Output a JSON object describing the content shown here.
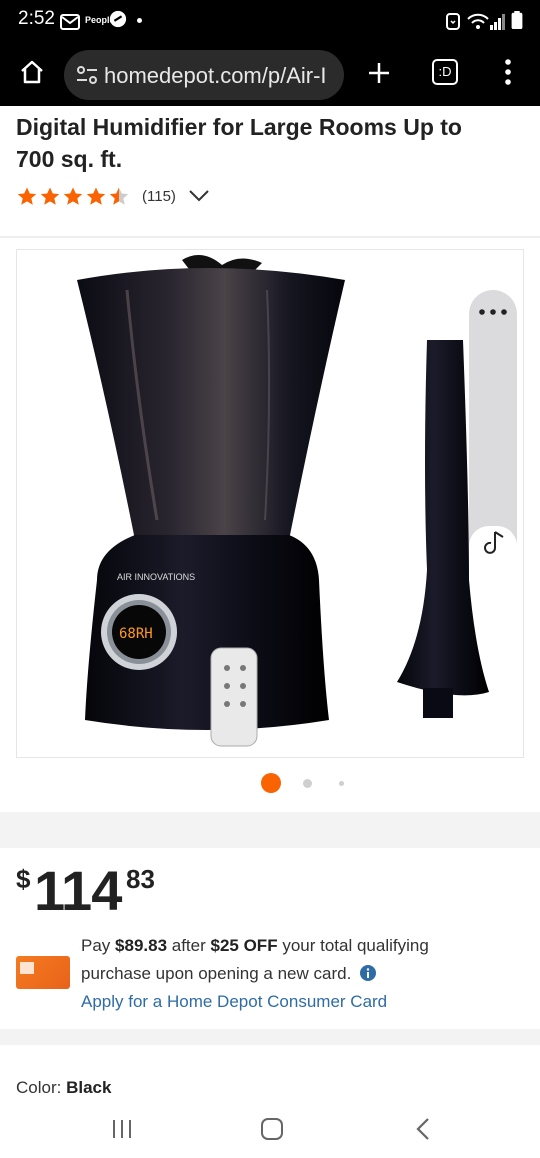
{
  "status": {
    "time": "2:52",
    "app_label": "People"
  },
  "browser": {
    "url": "homedepot.com/p/Air-I",
    "tab_count": ":D"
  },
  "product": {
    "title": "Digital Humidifier for Large Rooms Up to 700 sq. ft.",
    "rating": 4.5,
    "review_count": "(115)",
    "image_brand_text": "AIR INNOVATIONS",
    "image_display_text": "68RH",
    "gallery": {
      "total": 3,
      "active": 1
    }
  },
  "price": {
    "dollar_sign": "$",
    "dollars": "114",
    "cents": "83"
  },
  "promo": {
    "line1_prefix": "Pay ",
    "pay_amount": "$89.83",
    "line1_mid": " after ",
    "off_amount": "$25 OFF",
    "line1_suffix": " your total qualifying purchase upon opening a new card.",
    "link": "Apply for a Home Depot Consumer Card"
  },
  "options": {
    "color_label": "Color:",
    "color_value": "Black"
  },
  "colors": {
    "brand_orange": "#f96302",
    "star": "#f96302",
    "link": "#2f6ca6"
  }
}
